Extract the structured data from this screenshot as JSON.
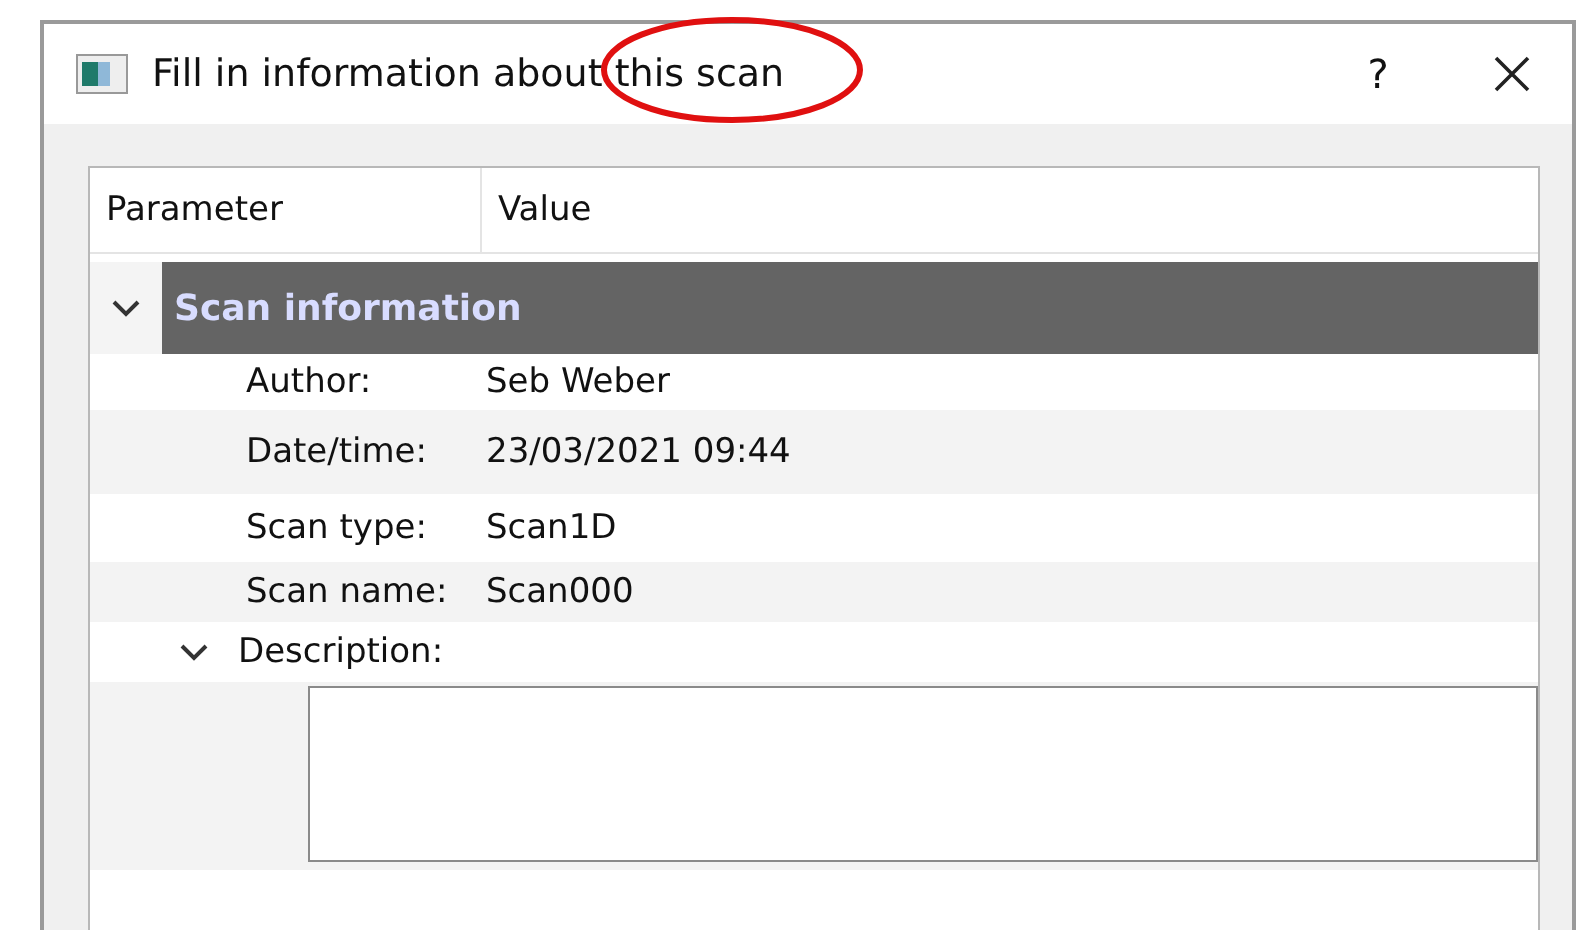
{
  "window": {
    "title": "Fill in information about this scan",
    "help": "?"
  },
  "table": {
    "columns": [
      "Parameter",
      "Value"
    ],
    "group": {
      "label": "Scan information",
      "expanded": true,
      "rows": [
        {
          "label": "Author:",
          "value": "Seb Weber"
        },
        {
          "label": "Date/time:",
          "value": "23/03/2021 09:44"
        },
        {
          "label": "Scan type:",
          "value": "Scan1D"
        },
        {
          "label": "Scan name:",
          "value": "Scan000"
        }
      ],
      "description": {
        "label": "Description:",
        "expanded": true
      }
    }
  }
}
